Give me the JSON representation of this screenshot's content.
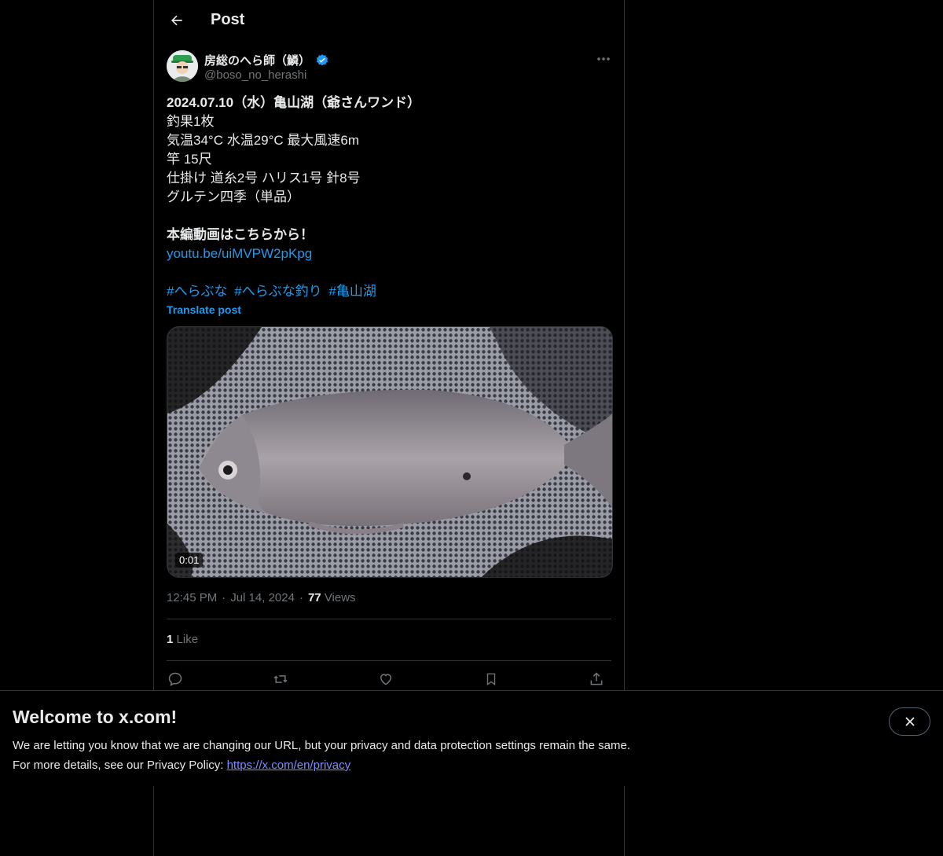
{
  "header": {
    "title": "Post"
  },
  "post": {
    "author_name": "房総のへら師（鱗）",
    "author_handle": "@boso_no_herashi",
    "lines": [
      "2024.07.10（水）亀山湖（爺さんワンド）",
      "釣果1枚",
      "気温34°C 水温29°C 最大風速6m",
      "竿 15尺",
      "仕掛け 道糸2号 ハリス1号 針8号",
      "グルテン四季（単品）",
      "",
      "本編動画はこちらから！"
    ],
    "link": "youtu.be/uiMVPW2pKpg",
    "hashtags": [
      "#へらぶな",
      "#へらぶな釣り",
      "#亀山湖"
    ],
    "translate": "Translate post",
    "video_duration": "0:01",
    "time": "12:45 PM",
    "date": "Jul 14, 2024",
    "separator": "·",
    "views_count": "77",
    "views_label": "Views",
    "likes_count": "1",
    "likes_label": "Like"
  },
  "icons": {
    "back": "arrow-left-icon",
    "more": "more-horizontal-icon",
    "verified": "verified-badge-icon",
    "reply": "reply-icon",
    "repost": "repost-icon",
    "like": "heart-icon",
    "bookmark": "bookmark-icon",
    "share": "share-icon",
    "close": "close-icon"
  },
  "colors": {
    "accent": "#1d9bf0",
    "background": "#000000",
    "text": "#e7e9ea",
    "muted": "#71767b",
    "border": "#2f3336"
  },
  "banner": {
    "title": "Welcome to x.com!",
    "line1": "We are letting you know that we are changing our URL, but your privacy and data protection settings remain the same.",
    "line2_prefix": "For more details, see our Privacy Policy: ",
    "link": "https://x.com/en/privacy"
  }
}
